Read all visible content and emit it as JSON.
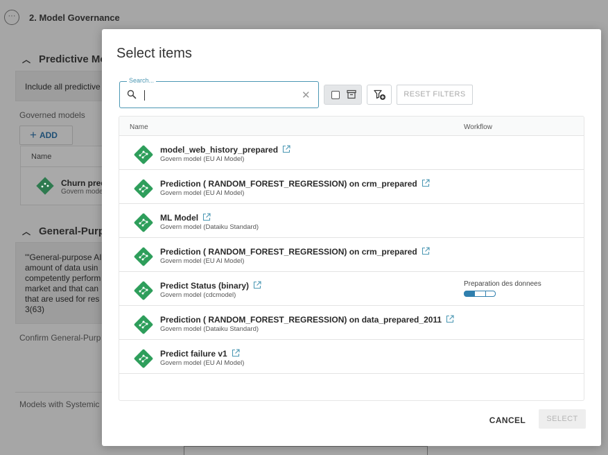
{
  "background": {
    "menu_glyph": "···",
    "governance_title": "2. Model Governance",
    "section1_title": "Predictive Mo",
    "section1_text": "Include all predictive",
    "governed_models_label": "Governed models",
    "add_button": "ADD",
    "table_header_name": "Name",
    "row_name": "Churn pred",
    "row_sub": "Govern mode",
    "section2_title": "General-Purpo",
    "section2_lines": [
      "'\"General-purpose AI",
      "amount of data usin",
      "competently perform",
      "market and that can",
      "that are used for res",
      "3(63)"
    ],
    "confirm_label": "Confirm General-Purp",
    "systemic_label": "Models with Systemic"
  },
  "modal": {
    "title": "Select items",
    "search": {
      "label": "Search...",
      "value": ""
    },
    "reset_filters": "RESET FILTERS",
    "columns": {
      "name": "Name",
      "workflow": "Workflow"
    },
    "rows": [
      {
        "name": "model_web_history_prepared",
        "sub": "Govern model (EU AI Model)",
        "workflow": ""
      },
      {
        "name": "Prediction ( RANDOM_FOREST_REGRESSION) on crm_prepared",
        "sub": "Govern model (EU AI Model)",
        "workflow": ""
      },
      {
        "name": "ML Model",
        "sub": "Govern model (Dataiku Standard)",
        "workflow": ""
      },
      {
        "name": "Prediction ( RANDOM_FOREST_REGRESSION) on crm_prepared",
        "sub": "Govern model (EU AI Model)",
        "workflow": ""
      },
      {
        "name": "Predict Status (binary)",
        "sub": "Govern model (cdcmodel)",
        "workflow": "Preparation des donnees",
        "workflow_progress": "1/3"
      },
      {
        "name": "Prediction ( RANDOM_FOREST_REGRESSION) on data_prepared_2011",
        "sub": "Govern model (Dataiku Standard)",
        "workflow": ""
      },
      {
        "name": "Predict failure v1",
        "sub": "Govern model (EU AI Model)",
        "workflow": ""
      }
    ],
    "cancel": "CANCEL",
    "select": "SELECT"
  },
  "colors": {
    "accent": "#4b97b3",
    "model_icon_green": "#2e9e5b",
    "workflow_blue": "#2f7fae",
    "overlay": "#a6a6a6"
  },
  "icons": {
    "search": "search-icon",
    "clear": "close-icon",
    "archive": "archive-icon",
    "filter": "filter-add-icon",
    "external": "external-link-icon",
    "model": "model-diamond-icon"
  }
}
